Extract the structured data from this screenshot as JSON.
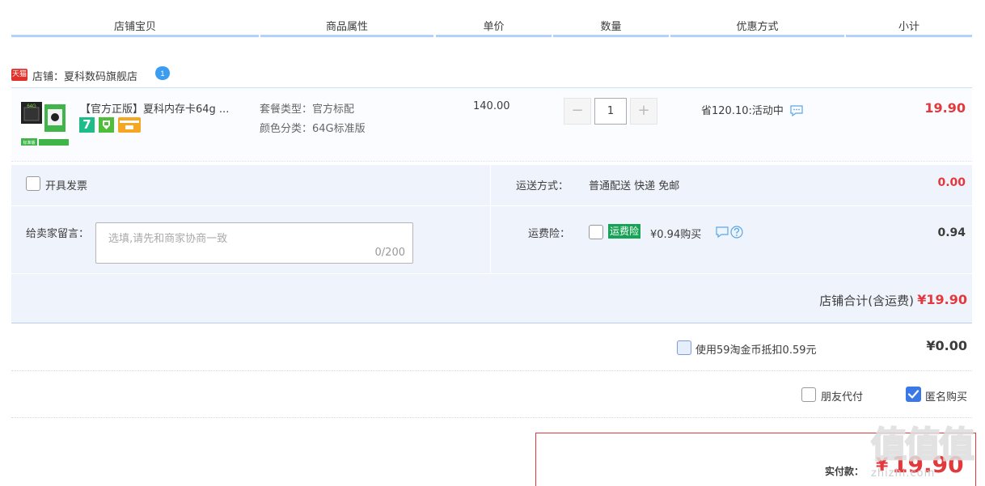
{
  "header": {
    "columns": [
      "店铺宝贝",
      "商品属性",
      "单价",
      "数量",
      "优惠方式",
      "小计"
    ]
  },
  "shop": {
    "badge": "天猫",
    "label": "店铺：夏科数码旗舰店",
    "ww_count": "1"
  },
  "item": {
    "thumb_tag": "64G",
    "thumb_bottom": "标准版",
    "title": "【官方正版】夏科内存卡64g ...",
    "badge_seven": "7",
    "sku": [
      "套餐类型：官方标配",
      "颜色分类：64G标准版"
    ],
    "unit_price": "140.00",
    "quantity": "1",
    "qty_minus": "−",
    "qty_plus": "+",
    "promo": "省120.10:活动中",
    "subtotal": "19.90"
  },
  "options": {
    "invoice_label": "开具发票",
    "shipping_label": "运送方式：",
    "shipping_value": "普通配送 快递 免邮",
    "shipping_price": "0.00",
    "message_label": "给卖家留言：",
    "message_placeholder": "选填,请先和商家协商一致",
    "message_count": "0/200",
    "insurance_label": "运费险：",
    "insurance_tag": "运费险",
    "insurance_text": "¥0.94购买",
    "insurance_price": "0.94",
    "shop_total_label": "店铺合计(含运费)",
    "shop_total_value": "¥19.90"
  },
  "coin": {
    "label": "使用59淘金币抵扣0.59元",
    "value": "¥0.00"
  },
  "extras": {
    "friend_pay": "朋友代付",
    "anonymous": "匿名购买"
  },
  "pay": {
    "label": "实付款：",
    "currency": "¥",
    "amount": "19.90"
  },
  "watermark": {
    "main": "值值值",
    "sub": "zhizhi.com"
  },
  "colors": {
    "price_red": "#e4393c",
    "header_line": "#b2d1ff",
    "panel_bg": "#eff4fc",
    "insurance_green": "#17a355",
    "check_blue": "#3a78e8"
  }
}
